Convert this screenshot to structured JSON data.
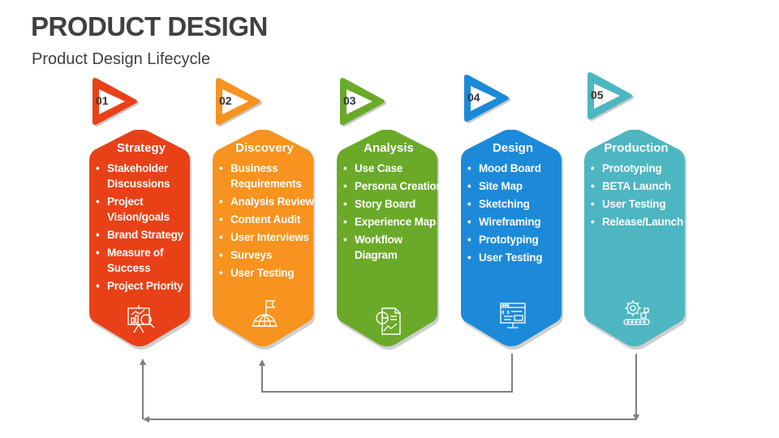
{
  "header": {
    "title": "PRODUCT DESIGN",
    "subtitle": "Product Design Lifecycle"
  },
  "stages": [
    {
      "number": "01",
      "title": "Strategy",
      "color": "#E84118",
      "icon": "presentation-analytics-icon",
      "items": [
        "Stakeholder Discussions",
        "Project Vision/goals",
        "Brand Strategy",
        "Measure of Success",
        "Project Priority"
      ]
    },
    {
      "number": "02",
      "title": "Discovery",
      "color": "#F7931E",
      "icon": "globe-flag-icon",
      "items": [
        "Business Requirements",
        "Analysis Review",
        "Content Audit",
        "User Interviews",
        "Surveys",
        "User Testing"
      ]
    },
    {
      "number": "03",
      "title": "Analysis",
      "color": "#6AAA28",
      "icon": "report-chart-icon",
      "items": [
        "Use Case",
        "Persona Creation",
        "Story Board",
        "Experience Map",
        "Workflow Diagram"
      ]
    },
    {
      "number": "04",
      "title": "Design",
      "color": "#1C8AD8",
      "icon": "web-design-monitor-icon",
      "items": [
        "Mood Board",
        "Site Map",
        "Sketching",
        "Wireframing",
        "Prototyping",
        "User Testing"
      ]
    },
    {
      "number": "05",
      "title": "Production",
      "color": "#4DB6C1",
      "icon": "gear-conveyor-icon",
      "items": [
        "Prototyping",
        "BETA Launch",
        "User Testing",
        "Release/Launch"
      ]
    }
  ],
  "connectors": [
    {
      "from": "Design",
      "to": "Discovery"
    },
    {
      "from": "Production",
      "to": "Strategy"
    }
  ],
  "colors": {
    "title_text": "#404040",
    "connector": "#7F7F7F",
    "border": "#D0D0D0"
  }
}
